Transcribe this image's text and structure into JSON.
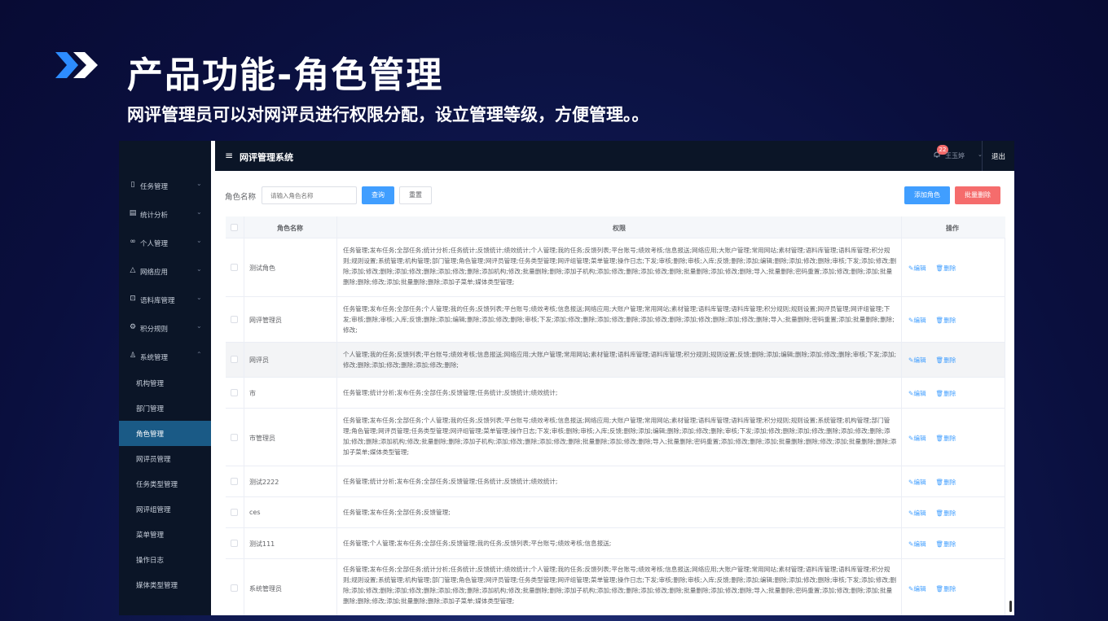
{
  "slide": {
    "title": "产品功能-角色管理",
    "subtitle": "网评管理员可以对网评员进行权限分配，设立管理等级，方便管理。。",
    "accent": "#2d8cff"
  },
  "header": {
    "menu_icon": "hamburger-icon",
    "title": "网评管理系统",
    "notification_count": "22",
    "user_name": "王玉婷",
    "logout": "退出"
  },
  "sidebar": {
    "items": [
      {
        "label": "任务管理",
        "icon": "clipboard-icon"
      },
      {
        "label": "统计分析",
        "icon": "document-icon"
      },
      {
        "label": "个人管理",
        "icon": "link-icon"
      },
      {
        "label": "网络应用",
        "icon": "bell-icon"
      },
      {
        "label": "语料库管理",
        "icon": "lock-icon"
      },
      {
        "label": "积分规则",
        "icon": "gear-icon"
      },
      {
        "label": "系统管理",
        "icon": "user-icon"
      }
    ],
    "sub_items": [
      {
        "label": "机构管理"
      },
      {
        "label": "部门管理"
      },
      {
        "label": "角色管理"
      },
      {
        "label": "网评员管理"
      },
      {
        "label": "任务类型管理"
      },
      {
        "label": "网评组管理"
      },
      {
        "label": "菜单管理"
      },
      {
        "label": "操作日志"
      },
      {
        "label": "媒体类型管理"
      }
    ],
    "active": "角色管理"
  },
  "toolbar": {
    "search_label": "角色名称",
    "search_placeholder": "请输入角色名称",
    "query": "查询",
    "reset": "重置",
    "add_role": "添加角色",
    "batch_delete": "批量删除"
  },
  "table": {
    "columns": [
      "角色名称",
      "权限",
      "操作"
    ],
    "edit_label": "编辑",
    "delete_label": "删除",
    "rows": [
      {
        "name": "测试角色",
        "perm": "任务管理;发布任务;全部任务;统计分析;任务统计;反馈统计;绩效统计;个人管理;我的任务;反馈列表;平台账号;绩效考核;信息报送;网络应用;大账户管理;常用网站;素材管理;语料库管理;语料库管理;积分规则;规则设置;系统管理;机构管理;部门管理;角色管理;网评员管理;任务类型管理;网评组管理;菜单管理;操作日志;下发;审核;删除;审核;入库;反馈;删除;添加;编辑;删除;添加;修改;删除;审核;下发;添加;修改;删除;添加;修改;删除;添加;修改;删除;添加;修改;删除;添加机构;修改;批量删除;删除;添加子机构;添加;修改;删除;添加;修改;删除;批量删除;添加;修改;删除;导入;批量删除;密码重置;添加;修改;删除;添加;批量删除;删除;修改;添加;批量删除;删除;添加子菜单;媒体类型管理;"
      },
      {
        "name": "网评管理员",
        "perm": "任务管理;发布任务;全部任务;个人管理;我的任务;反馈列表;平台账号;绩效考核;信息报送;网络应用;大账户管理;常用网站;素材管理;语料库管理;语料库管理;积分规则;规则设置;网评员管理;网评组管理;下发;审核;删除;审核;入库;反馈;删除;添加;编辑;删除;添加;修改;删除;审核;下发;添加;修改;删除;添加;修改;删除;添加;修改;删除;添加;修改;删除;添加;修改;删除;导入;批量删除;密码重置;添加;批量删除;删除;修改;"
      },
      {
        "name": "网评员",
        "perm": "个人管理;我的任务;反馈列表;平台账号;绩效考核;信息报送;网络应用;大账户管理;常用网站;素材管理;语料库管理;语料库管理;积分规则;规则设置;反馈;删除;添加;编辑;删除;添加;修改;删除;审核;下发;添加;修改;删除;添加;修改;删除;添加;修改;删除;"
      },
      {
        "name": "市",
        "perm": "任务管理;统计分析;发布任务;全部任务;反馈管理;任务统计;反馈统计;绩效统计;"
      },
      {
        "name": "市管理员",
        "perm": "任务管理;发布任务;全部任务;个人管理;我的任务;反馈列表;平台账号;绩效考核;信息报送;网络应用;大账户管理;常用网站;素材管理;语料库管理;语料库管理;积分规则;规则设置;系统管理;机构管理;部门管理;角色管理;网评员管理;任务类型管理;网评组管理;菜单管理;操作日志;下发;审核;删除;审核;入库;反馈;删除;添加;编辑;删除;添加;修改;删除;审核;下发;添加;修改;删除;添加;修改;删除;添加;修改;删除;添加;修改;删除;添加机构;修改;批量删除;删除;添加子机构;添加;修改;删除;添加;修改;删除;批量删除;添加;修改;删除;导入;批量删除;密码重置;添加;修改;删除;添加;批量删除;删除;修改;添加;批量删除;删除;添加子菜单;媒体类型管理;"
      },
      {
        "name": "测试2222",
        "perm": "任务管理;统计分析;发布任务;全部任务;反馈管理;任务统计;反馈统计;绩效统计;"
      },
      {
        "name": "ces",
        "perm": "任务管理;发布任务;全部任务;反馈管理;"
      },
      {
        "name": "测试111",
        "perm": "任务管理;个人管理;发布任务;全部任务;反馈管理;我的任务;反馈列表;平台账号;绩效考核;信息报送;"
      },
      {
        "name": "系统管理员",
        "perm": "任务管理;发布任务;全部任务;统计分析;任务统计;反馈统计;绩效统计;个人管理;我的任务;反馈列表;平台账号;绩效考核;信息报送;网络应用;大账户管理;常用网站;素材管理;语料库管理;语料库管理;积分规则;规则设置;系统管理;机构管理;部门管理;角色管理;网评员管理;任务类型管理;网评组管理;菜单管理;操作日志;下发;审核;删除;审核;入库;反馈;删除;添加;编辑;删除;添加;修改;删除;审核;下发;添加;修改;删除;添加;修改;删除;添加;修改;删除;添加;修改;删除;添加机构;修改;批量删除;删除;添加子机构;添加;修改;删除;添加;修改;删除;批量删除;添加;修改;删除;导入;批量删除;密码重置;添加;修改;删除;添加;批量删除;删除;修改;添加;批量删除;删除;添加子菜单;媒体类型管理;"
      }
    ]
  }
}
